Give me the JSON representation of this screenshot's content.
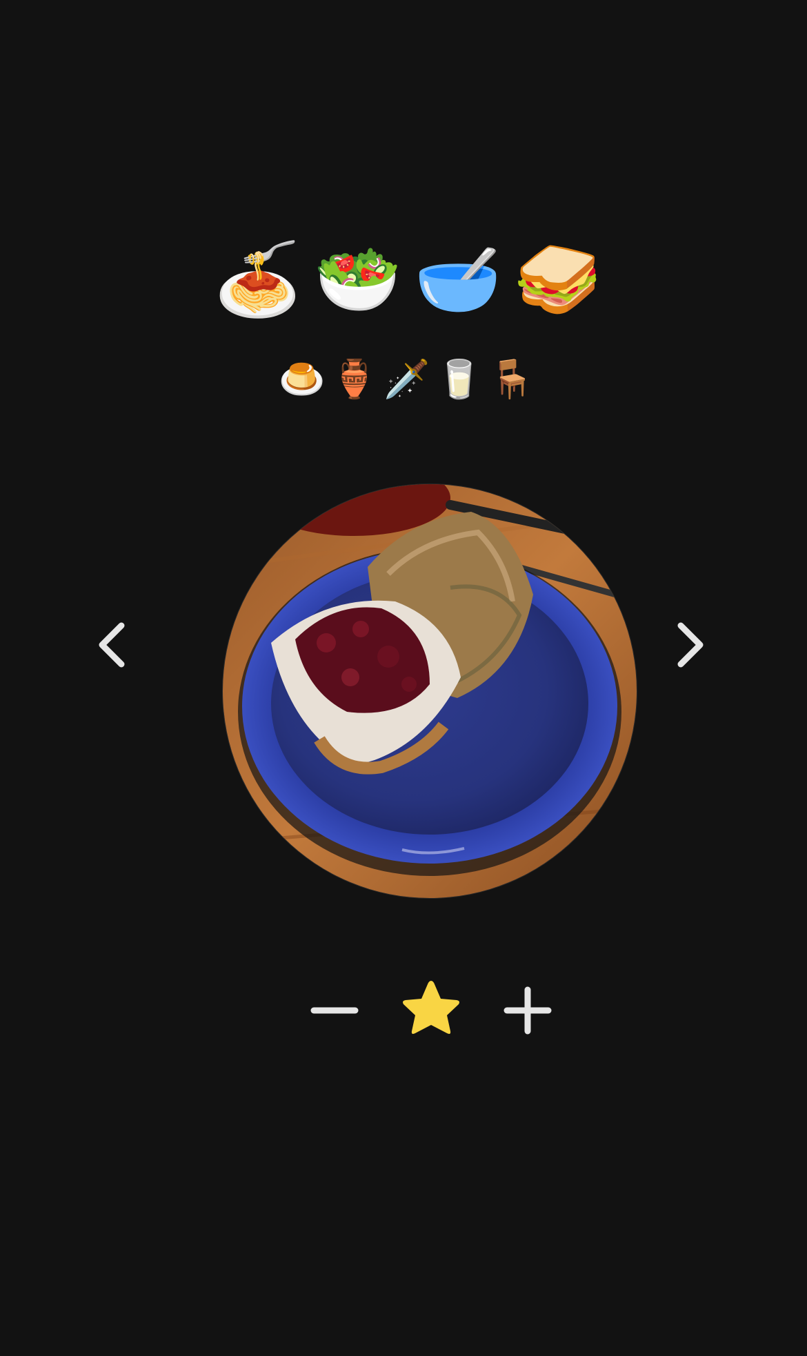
{
  "categories_primary": [
    {
      "id": "spaghetti",
      "emoji": "🍝",
      "icon": "spaghetti-icon"
    },
    {
      "id": "salad",
      "emoji": "🥗",
      "icon": "salad-icon"
    },
    {
      "id": "bowl",
      "emoji": "🥣",
      "icon": "bowl-with-spoon-icon"
    },
    {
      "id": "sandwich",
      "emoji": "🥪",
      "icon": "sandwich-icon"
    }
  ],
  "categories_secondary": [
    {
      "id": "custard",
      "emoji": "🍮",
      "icon": "custard-icon"
    },
    {
      "id": "amphora",
      "emoji": "🏺",
      "icon": "amphora-icon"
    },
    {
      "id": "dagger",
      "emoji": "🗡️",
      "icon": "dagger-icon"
    },
    {
      "id": "milk",
      "emoji": "🥛",
      "icon": "glass-of-milk-icon"
    },
    {
      "id": "chair",
      "emoji": "🪑",
      "icon": "chair-icon"
    }
  ],
  "navigation": {
    "prev_icon": "chevron-left-icon",
    "next_icon": "chevron-right-icon"
  },
  "photo": {
    "subject": "plate-of-food-photo"
  },
  "rating": {
    "decrease_icon": "minus-icon",
    "star_icon": "star-icon",
    "increase_icon": "plus-icon",
    "star_color": "#F9D544"
  },
  "colors": {
    "background": "#121212",
    "control": "#E6E6E6",
    "plate": "#2B3A9A"
  }
}
